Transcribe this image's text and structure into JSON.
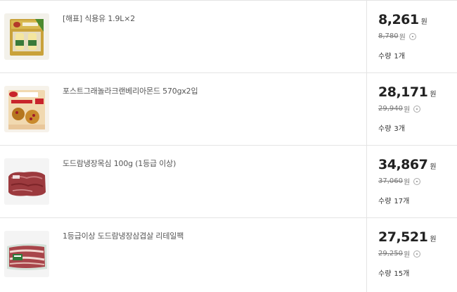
{
  "items": [
    {
      "name": "[해표] 식용유 1.9L×2",
      "price": "8,261",
      "orig_price": "8,780",
      "currency": "원",
      "qty_label": "수량",
      "qty": "1개",
      "thumb_icon": "cooking-oil-product-image"
    },
    {
      "name": "포스트그래놀라크랜베리아몬드 570gx2입",
      "price": "28,171",
      "orig_price": "29,940",
      "currency": "원",
      "qty_label": "수량",
      "qty": "3개",
      "thumb_icon": "granola-product-image"
    },
    {
      "name": "도드람냉장목심 100g (1등급 이상)",
      "price": "34,867",
      "orig_price": "37,060",
      "currency": "원",
      "qty_label": "수량",
      "qty": "17개",
      "thumb_icon": "pork-neck-product-image"
    },
    {
      "name": "1등급이상 도드람냉장삼겹살 리테일팩",
      "price": "27,521",
      "orig_price": "29,250",
      "currency": "원",
      "qty_label": "수량",
      "qty": "15개",
      "thumb_icon": "pork-belly-product-image"
    }
  ],
  "colors": {
    "border": "#e4e4e4",
    "price": "#222222",
    "muted": "#777777"
  }
}
